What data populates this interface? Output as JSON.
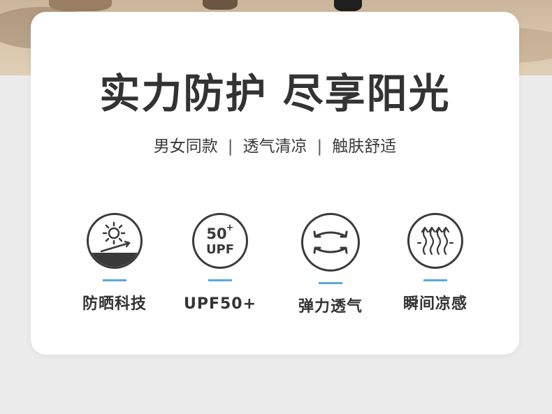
{
  "headline": "实力防护 尽享阳光",
  "subline": {
    "parts": [
      "男女同款",
      "透气清凉",
      "触肤舒适"
    ],
    "separator": "|"
  },
  "features": [
    {
      "label": "防晒科技",
      "icon": "sun-protection-icon"
    },
    {
      "label": "UPF50+",
      "icon": "upf50-badge-icon",
      "badge_top": "50",
      "badge_plus": "+",
      "badge_bottom": "UPF"
    },
    {
      "label": "弹力透气",
      "icon": "stretch-arrows-icon"
    },
    {
      "label": "瞬间凉感",
      "icon": "cooling-airflow-icon"
    }
  ],
  "colors": {
    "accent_dash": "#5aa7de",
    "text_dark": "#333333",
    "card_bg": "#ffffff",
    "page_bg": "#ececec"
  }
}
